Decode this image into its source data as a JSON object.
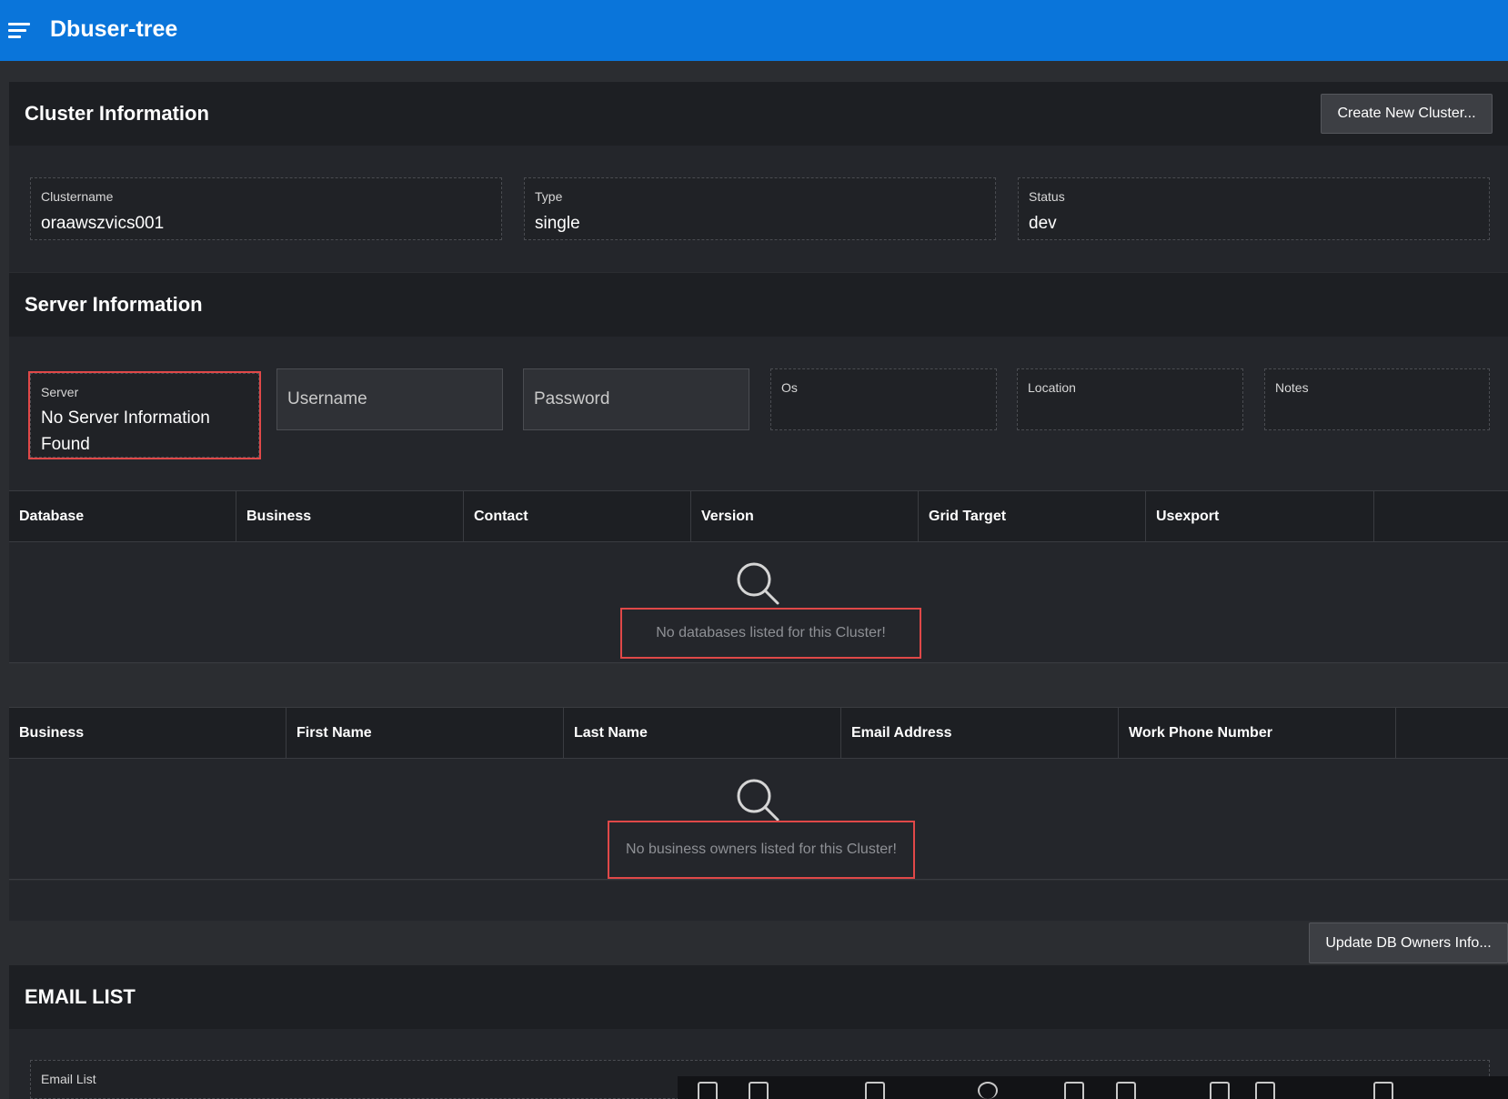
{
  "app": {
    "title": "Dbuser-tree",
    "menu_icon": "hamburger-icon"
  },
  "cluster": {
    "title": "Cluster Information",
    "create_button": "Create New Cluster...",
    "fields": [
      {
        "label": "Clustername",
        "value": "oraawszvics001"
      },
      {
        "label": "Type",
        "value": "single"
      },
      {
        "label": "Status",
        "value": "dev"
      }
    ]
  },
  "server": {
    "title": "Server Information",
    "server_label": "Server",
    "server_value_line1": "No Server Information",
    "server_value_line2": "Found",
    "username_placeholder": "Username",
    "password_placeholder": "Password",
    "os_label": "Os",
    "location_label": "Location",
    "notes_label": "Notes"
  },
  "databases_grid": {
    "columns": [
      "Database",
      "Business",
      "Contact",
      "Version",
      "Grid Target",
      "Usexport"
    ],
    "empty_icon": "search-icon",
    "empty_message": "No databases listed for this Cluster!"
  },
  "owners_grid": {
    "columns": [
      "Business",
      "First Name",
      "Last Name",
      "Email Address",
      "Work Phone Number"
    ],
    "empty_icon": "search-icon",
    "empty_message": "No business owners listed for this Cluster!"
  },
  "update_button": "Update DB Owners Info...",
  "email": {
    "title": "EMAIL LIST",
    "field_label": "Email List"
  },
  "colors": {
    "topbar": "#0a75da",
    "background": "#2b2d31",
    "panel": "#24262b",
    "highlight": "#e04848"
  }
}
